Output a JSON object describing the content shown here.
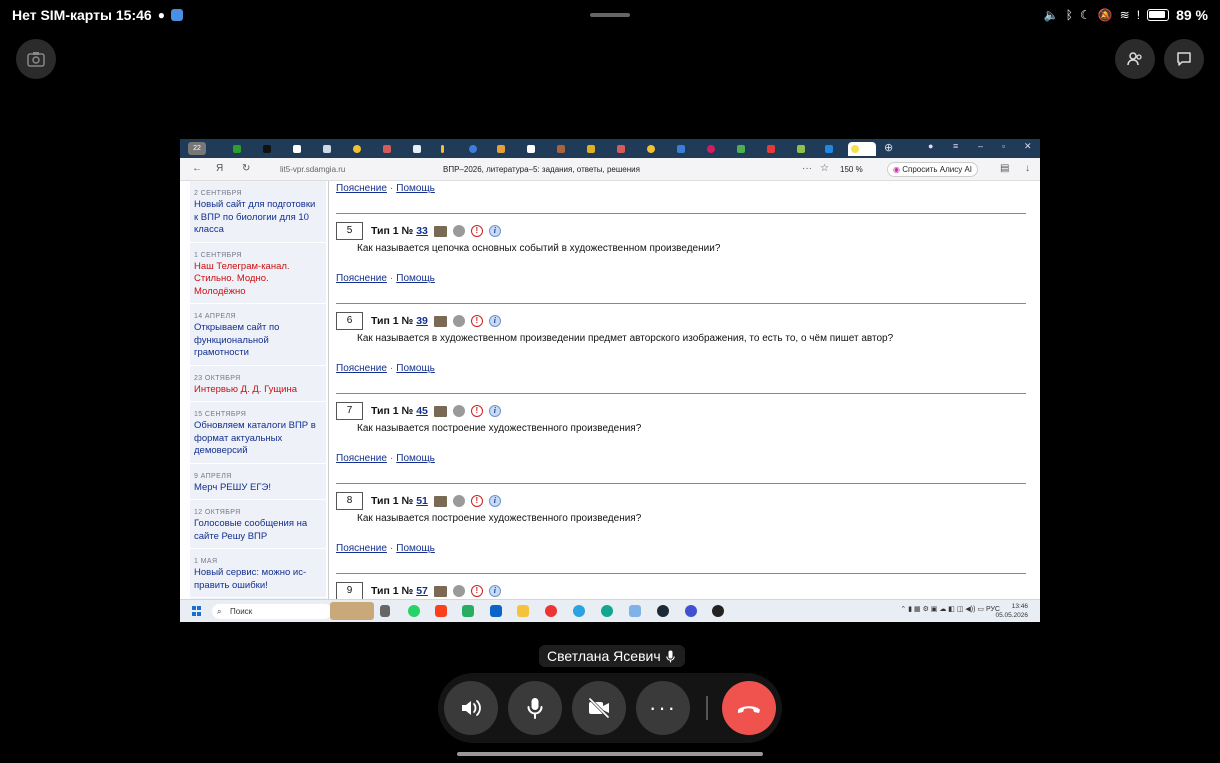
{
  "status_bar": {
    "carrier_time": "Нет SIM-карты 15:46",
    "battery": "89 %"
  },
  "browser": {
    "tab_count": "22",
    "url": "lit5-vpr.sdamgia.ru",
    "title": "ВПР–2026, литература–5: задания, ответы, решения",
    "zoom": "150 %",
    "alice_label": "Спросить Алису AI"
  },
  "sidebar": {
    "news": [
      {
        "date": "2 СЕНТЯБРЯ",
        "title": "Новый сайт для подготовки к ВПР по биологии для 10 класса",
        "red": false
      },
      {
        "date": "1 СЕНТЯБРЯ",
        "title": "Наш Телеграм-канал. Стильно. Модно. Молодёжно",
        "red": true
      },
      {
        "date": "14 АПРЕЛЯ",
        "title": "Открываем сайт по функциональной грамотности",
        "red": false
      },
      {
        "date": "23 ОКТЯБРЯ",
        "title": "Интервью Д. Д. Гущина",
        "red": true
      },
      {
        "date": "15 СЕНТЯБРЯ",
        "title": "Обновляем каталоги ВПР в формат актуальных демоверсий",
        "red": false
      },
      {
        "date": "9 АПРЕЛЯ",
        "title": "Мерч РЕШУ ЕГЭ!",
        "red": false
      },
      {
        "date": "12 ОКТЯБРЯ",
        "title": "Голосовые сообщения на сайте Решу ВПР",
        "red": false
      },
      {
        "date": "1 МАЯ",
        "title": "Новый сервис: можно ис-править ошибки!",
        "red": false
      }
    ]
  },
  "main": {
    "explain_label": "Пояснение",
    "help_label": "Помощь",
    "type_label": "Тип 1 №",
    "tasks": [
      {
        "n": "5",
        "id": "33",
        "q": "Как называется цепочка основных событий в художественном произведении?"
      },
      {
        "n": "6",
        "id": "39",
        "q": "Как называется в художественном произведении предмет авторского изображения, то есть то, о чём пишет автор?"
      },
      {
        "n": "7",
        "id": "45",
        "q": "Как называется построение художественного произведения?"
      },
      {
        "n": "8",
        "id": "51",
        "q": "Как называется построение художественного произведения?"
      },
      {
        "n": "9",
        "id": "57",
        "q": ""
      }
    ]
  },
  "taskbar": {
    "search_placeholder": "Поиск",
    "lang": "РУС",
    "time": "13:46",
    "date": "05.05.2026"
  },
  "call": {
    "caller_name": "Светлана Ясевич"
  }
}
